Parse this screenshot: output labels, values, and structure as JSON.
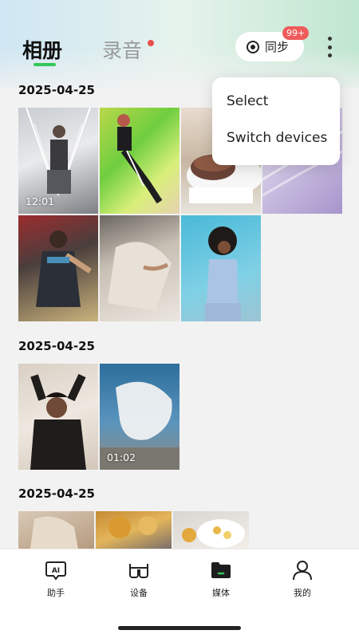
{
  "header": {
    "tabs": [
      {
        "label": "相册",
        "active": true
      },
      {
        "label": "录音",
        "active": false,
        "has_dot": true
      }
    ],
    "sync_button": {
      "label": "同步",
      "badge": "99+"
    },
    "accent_color": "#34c759",
    "badge_color": "#ef5b5b"
  },
  "menu": {
    "items": [
      {
        "label": "Select"
      },
      {
        "label": "Switch devices"
      }
    ]
  },
  "sections": [
    {
      "date": "2025-04-25",
      "photos": [
        {
          "icon": "photo-fashion-lights",
          "duration": "12:01"
        },
        {
          "icon": "photo-green-lime"
        },
        {
          "icon": "photo-food-dish"
        },
        {
          "icon": "photo-lavender-fabric"
        },
        {
          "icon": "photo-man-street-wall"
        },
        {
          "icon": "photo-beige-pants"
        },
        {
          "icon": "photo-woman-blue-wall"
        }
      ]
    },
    {
      "date": "2025-04-25",
      "photos": [
        {
          "icon": "photo-woman-black-dress"
        },
        {
          "icon": "photo-white-fabric-sky",
          "duration": "01:02"
        }
      ]
    },
    {
      "date": "2025-04-25",
      "photos": [
        {
          "icon": "photo-beige-jacket"
        },
        {
          "icon": "photo-autumn-tree"
        },
        {
          "icon": "photo-fruit-plate"
        }
      ]
    }
  ],
  "bottom_nav": {
    "items": [
      {
        "label": "助手",
        "icon": "ai-assistant-icon",
        "active": false
      },
      {
        "label": "设备",
        "icon": "glasses-icon",
        "active": false
      },
      {
        "label": "媒体",
        "icon": "folder-icon",
        "active": true
      },
      {
        "label": "我的",
        "icon": "person-icon",
        "active": false
      }
    ]
  }
}
